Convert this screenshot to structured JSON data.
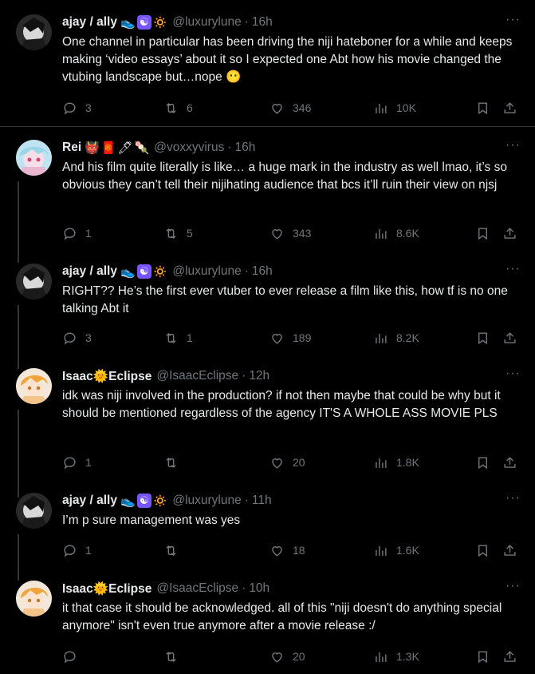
{
  "colors": {
    "background": "#000000",
    "text": "#e7e9ea",
    "muted": "#71767b",
    "divider": "#2f3336",
    "thread_line": "#333639"
  },
  "posts": [
    {
      "name": "ajay / ally",
      "emojis": [
        "sneaker-emoji",
        "yin-yang-emoji",
        "sun-emoji"
      ],
      "handle": "@luxurylune",
      "time": "16h",
      "text": "One channel in particular has been driving the niji hateboner for a while and keeps making ‘video essays’ about it so I expected one Abt how his movie changed the vtubing landscape but…nope 😶",
      "replies": "3",
      "reposts": "6",
      "likes": "346",
      "views": "10K"
    },
    {
      "name": "Rei",
      "emojis": [
        "ogre-emoji",
        "red-envelope-emoji",
        "pen-emoji",
        "dango-emoji"
      ],
      "handle": "@voxxyvirus",
      "time": "16h",
      "text": "And his film quite literally is like… a huge mark in the industry as well lmao, it’s so obvious they can’t tell their nijihating audience that bcs it’ll ruin their view on njsj",
      "replies": "1",
      "reposts": "5",
      "likes": "343",
      "views": "8.6K"
    },
    {
      "name": "ajay / ally",
      "emojis": [
        "sneaker-emoji",
        "yin-yang-emoji",
        "sun-emoji"
      ],
      "handle": "@luxurylune",
      "time": "16h",
      "text": "RIGHT?? He’s the first ever vtuber to ever release a film like this, how tf is no one talking Abt it",
      "replies": "3",
      "reposts": "1",
      "likes": "189",
      "views": "8.2K"
    },
    {
      "name": "Isaac",
      "name_suffix": "Eclipse",
      "emojis": [
        "sun-face-emoji"
      ],
      "handle": "@IsaacEclipse",
      "time": "12h",
      "text": "idk was niji involved in the production? if not then maybe that could be why but it should be mentioned regardless of the agency IT'S A WHOLE ASS MOVIE PLS",
      "replies": "1",
      "reposts": "",
      "likes": "20",
      "views": "1.8K"
    },
    {
      "name": "ajay / ally",
      "emojis": [
        "sneaker-emoji",
        "yin-yang-emoji",
        "sun-emoji"
      ],
      "handle": "@luxurylune",
      "time": "11h",
      "text": "I’m p sure management was yes",
      "replies": "1",
      "reposts": "",
      "likes": "18",
      "views": "1.6K"
    },
    {
      "name": "Isaac",
      "name_suffix": "Eclipse",
      "emojis": [
        "sun-face-emoji"
      ],
      "handle": "@IsaacEclipse",
      "time": "10h",
      "text": "it that case it should be acknowledged. all of this \"niji doesn't do anything special anymore\" isn't even true anymore after a movie release :/",
      "replies": "",
      "reposts": "",
      "likes": "20",
      "views": "1.3K"
    }
  ]
}
